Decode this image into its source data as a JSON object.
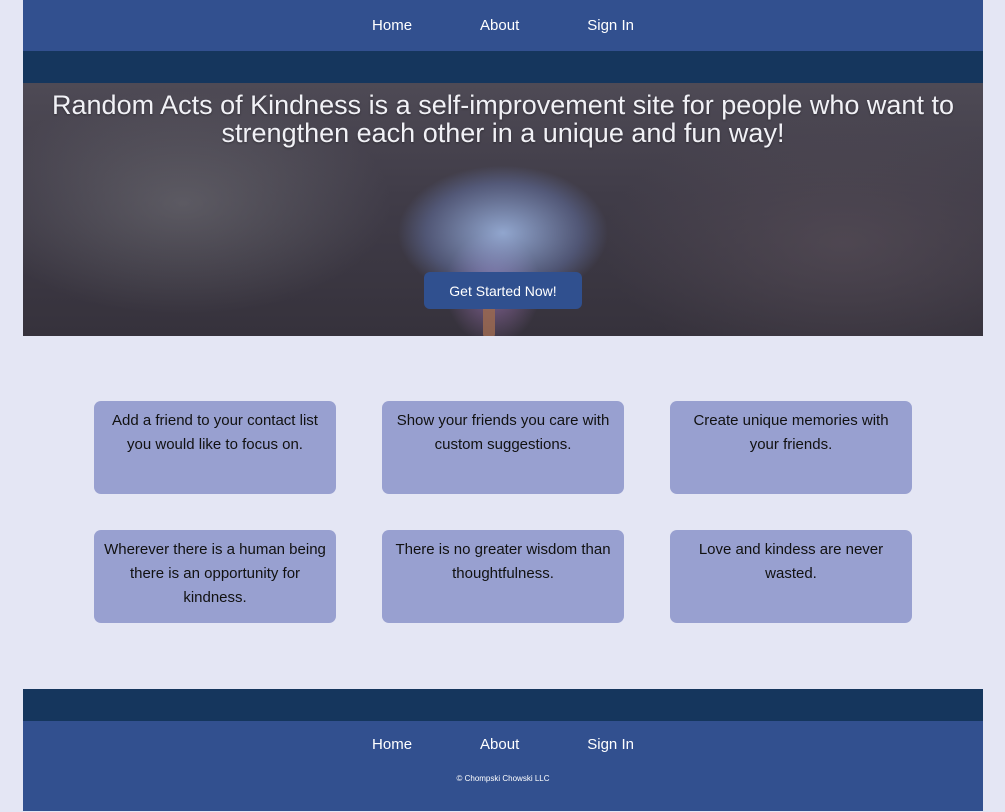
{
  "nav": {
    "home": "Home",
    "about": "About",
    "signin": "Sign In"
  },
  "hero": {
    "title": "Random Acts of Kindness is a self-improvement site for people who want to strengthen each other in a unique and fun way!",
    "cta_label": "Get Started Now!"
  },
  "cards": [
    "Add a friend to your contact list you would like to focus on.",
    "Show your friends you care with custom suggestions.",
    "Create unique memories with your friends.",
    "Wherever there is a human being there is an opportunity for kindness.",
    "There is no greater wisdom than thoughtfulness.",
    "Love and kindess are never wasted."
  ],
  "footer": {
    "home": "Home",
    "about": "About",
    "signin": "Sign In",
    "copyright": "© Chompski Chowski LLC"
  },
  "colors": {
    "nav_bg": "#32508f",
    "band_bg": "#15365d",
    "page_bg": "#e4e6f4",
    "card_bg": "#98a0d0"
  }
}
